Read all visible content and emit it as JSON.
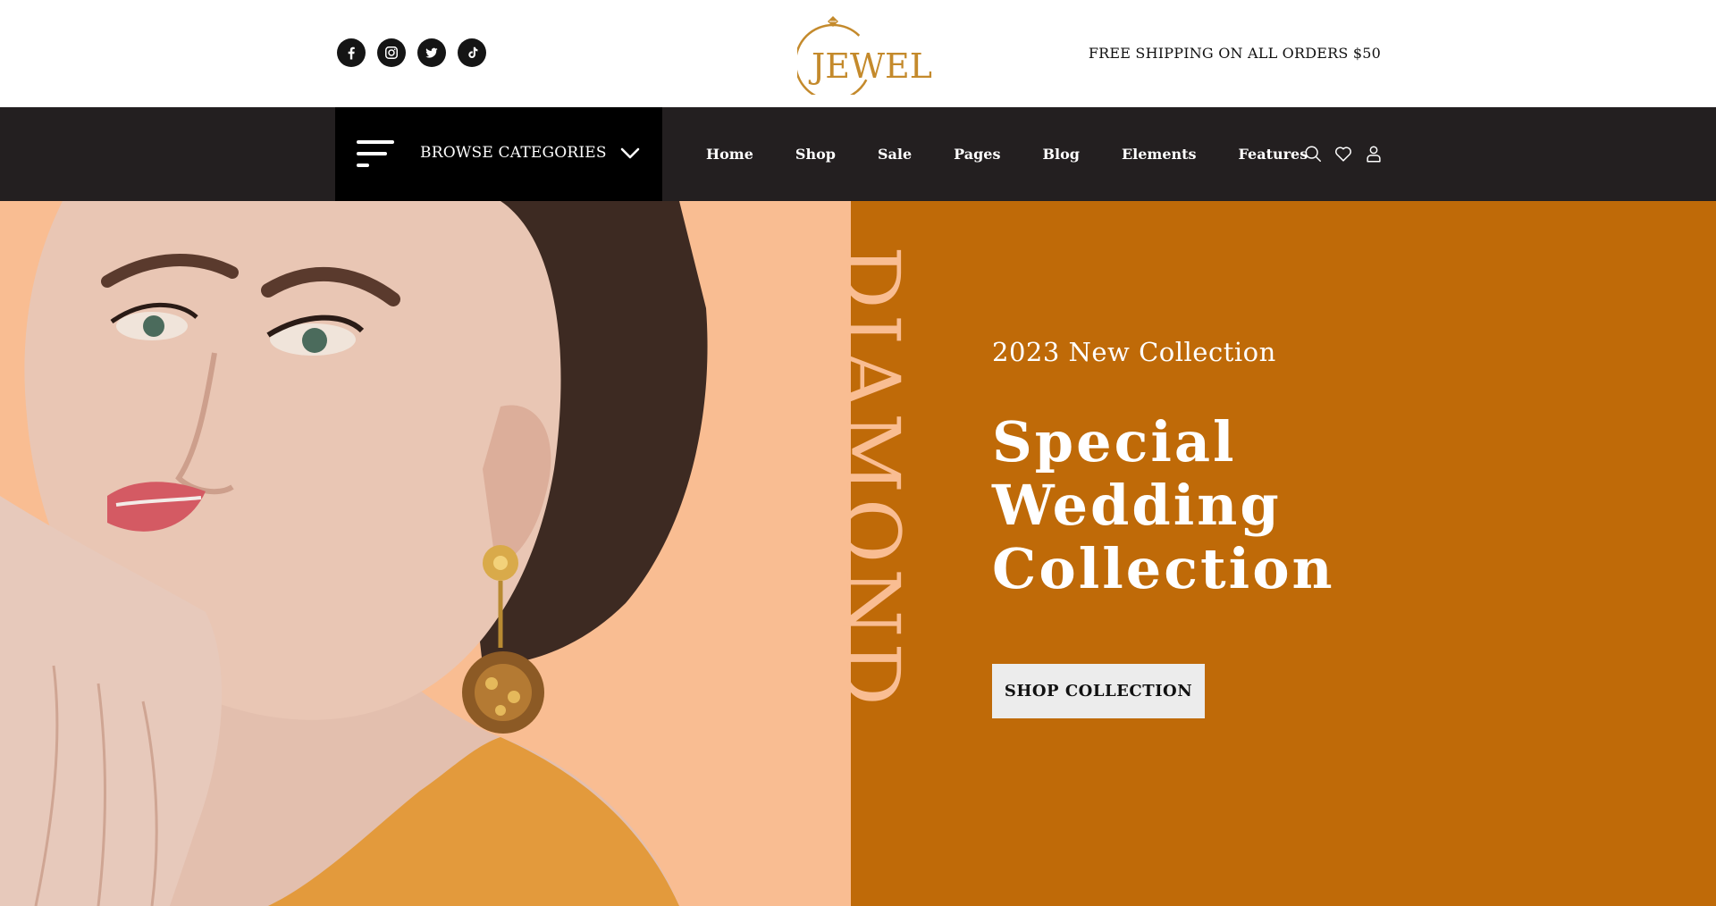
{
  "header": {
    "socials": [
      {
        "icon": "facebook-icon"
      },
      {
        "icon": "instagram-icon"
      },
      {
        "icon": "twitter-icon"
      },
      {
        "icon": "tiktok-icon"
      }
    ],
    "logo_text": "JEWEL",
    "shipping_notice": "FREE SHIPPING ON ALL ORDERS $50"
  },
  "nav": {
    "browse_label": "BROWSE CATEGORIES",
    "items": [
      {
        "label": "Home"
      },
      {
        "label": "Shop"
      },
      {
        "label": "Sale"
      },
      {
        "label": "Pages"
      },
      {
        "label": "Blog"
      },
      {
        "label": "Elements"
      },
      {
        "label": "Features"
      }
    ],
    "icons": [
      "search-icon",
      "heart-icon",
      "user-icon"
    ]
  },
  "hero": {
    "vertical_word": "DIAMOND",
    "subtitle": "2023 New Collection",
    "headline_lines": [
      "Special",
      "Wedding",
      "Collection"
    ],
    "cta_label": "SHOP COLLECTION"
  },
  "colors": {
    "brand_gold": "#c48a2c",
    "nav_dark": "#231f20",
    "browse_black": "#000000",
    "hero_peach": "#f9bd92",
    "hero_orange": "#bf6a08",
    "cta_bg": "#ececec"
  }
}
